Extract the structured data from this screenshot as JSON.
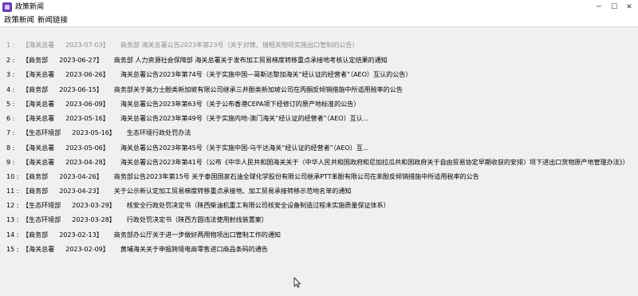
{
  "window": {
    "title": "政策新闻",
    "minimize": "─",
    "maximize": "☐",
    "close": "✕"
  },
  "menu": [
    "政策新闻",
    "新闻链接"
  ],
  "news": [
    {
      "index": "1 :",
      "source": "【海关总署",
      "date": "2023-07-03】",
      "title": "商务部 海关总署公告2023年第23号（关于对镓、锗相关物项实施出口管制的公告）",
      "dim": true
    },
    {
      "index": "2 :",
      "source": "【商务部",
      "date": "2023-06-27】",
      "title": "商务部 人力资源社会保障部 海关总署关于发布加工贸易梯度转移重点承接地考核认定结果的通知",
      "dim": false
    },
    {
      "index": "3 :",
      "source": "【海关总署",
      "date": "2023-06-26】",
      "title": "海关总署公告2023年第74号（关于实施中国—哥斯达黎加海关“经认证的经营者”（AEO）互认的公告）",
      "dim": false
    },
    {
      "index": "4 :",
      "source": "【商务部",
      "date": "2023-06-15】",
      "title": "商务部关于英力士酚类新加坡有限公司继承三井酚类新加坡公司在丙酮反倾销措施中所适用税率的公告",
      "dim": false
    },
    {
      "index": "5 :",
      "source": "【海关总署",
      "date": "2023-06-09】",
      "title": "海关总署公告2023年第63号（关于公布香港CEPA项下经修订的原产地标准的公告）",
      "dim": false
    },
    {
      "index": "6 :",
      "source": "【海关总署",
      "date": "2023-05-16】",
      "title": "海关总署公告2023年第49号（关于实施内地-澳门海关“经认证的经营者”（AEO）互认...",
      "dim": false
    },
    {
      "index": "7 :",
      "source": "【生态环境部",
      "date": "2023-05-16】",
      "title": "生态环境行政处罚办法",
      "dim": false
    },
    {
      "index": "8 :",
      "source": "【海关总署",
      "date": "2023-05-06】",
      "title": "海关总署公告2023年第45号（关于实施中国-乌干达海关“经认证的经营者”（AEO）互...",
      "dim": false
    },
    {
      "index": "9 :",
      "source": "【海关总署",
      "date": "2023-04-28】",
      "title": "海关总署公告2023年第41号（公布《中华人民共和国海关关于〈中华人民共和国政府和尼加拉瓜共和国政府关于自由贸易协定早期收获的安排〉项下进出口货物原产地管理办法》）",
      "dim": false
    },
    {
      "index": "10 :",
      "source": "【商务部",
      "date": "2023-04-26】",
      "title": "商务部公告2023年第15号 关于泰国国家石油全球化学股份有限公司继承PTT苯酚有限公司在苯酚反倾销措施中所适用税率的公告",
      "dim": false
    },
    {
      "index": "11 :",
      "source": "【商务部",
      "date": "2023-04-23】",
      "title": "关于公示新认定加工贸易梯度转移重点承接地、加工贸易承接转移示范地名单的通知",
      "dim": false
    },
    {
      "index": "12 :",
      "source": "【生态环境部",
      "date": "2023-03-29】",
      "title": "核安全行政处罚决定书（陕西柴油机重工有限公司核安全设备制造过程未实施质量保证体系）",
      "dim": false
    },
    {
      "index": "13 :",
      "source": "【生态环境部",
      "date": "2023-03-28】",
      "title": "行政处罚决定书（陕西方圆违法使用射线装置案）",
      "dim": false
    },
    {
      "index": "14 :",
      "source": "【商务部",
      "date": "2023-02-13】",
      "title": "商务部办公厅关于进一步做好两用物项出口管制工作的通知",
      "dim": false
    },
    {
      "index": "15 :",
      "source": "【海关总署",
      "date": "2023-02-09】",
      "title": "黄埔海关关于申报跨境电商零售进口商品条码的通告",
      "dim": false
    }
  ]
}
